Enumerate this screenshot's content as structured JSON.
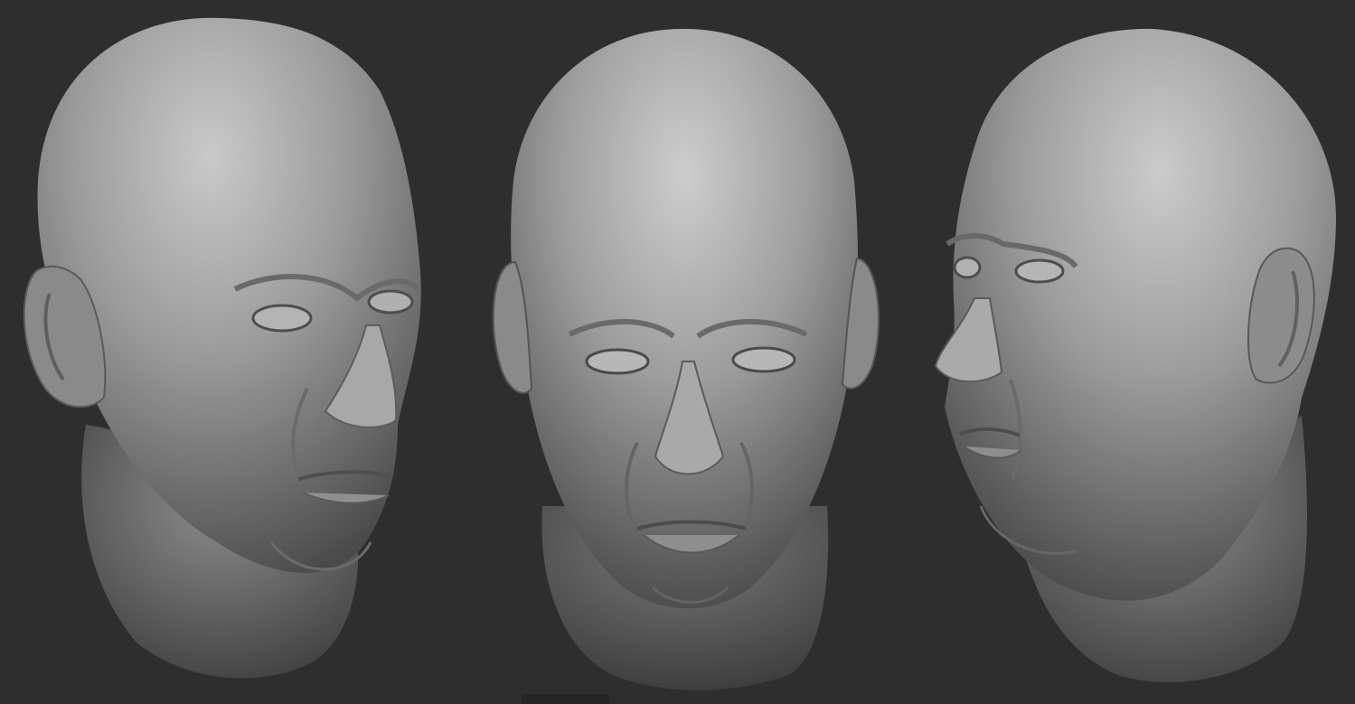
{
  "scene": {
    "background_color": "#2e2e2e",
    "clay_color": "#9a9a9a",
    "views": [
      {
        "id": "three-quarter-left",
        "label": ""
      },
      {
        "id": "front",
        "label": ""
      },
      {
        "id": "three-quarter-right",
        "label": ""
      }
    ]
  }
}
